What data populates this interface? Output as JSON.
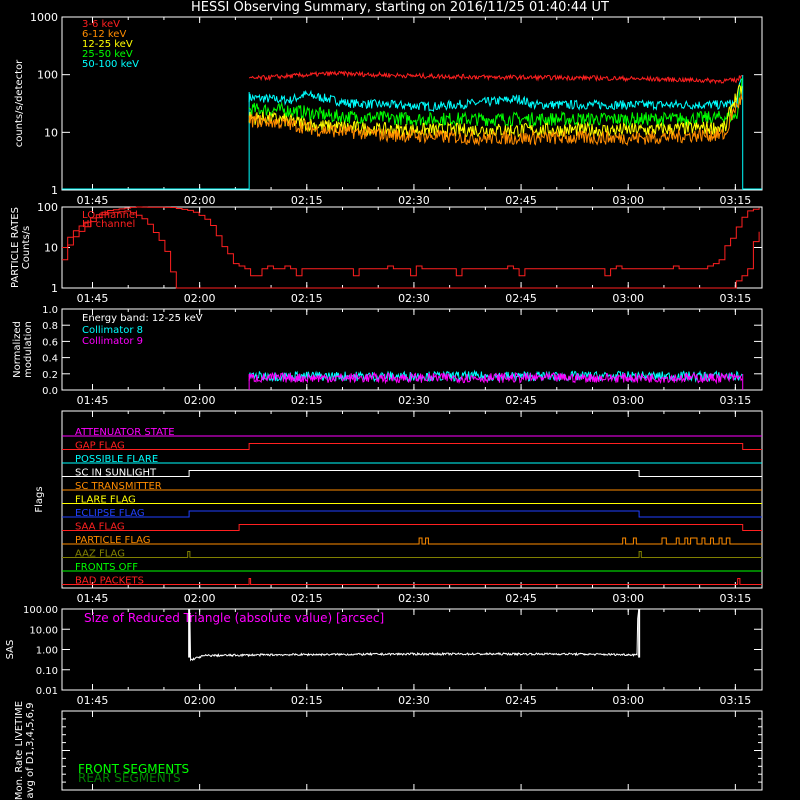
{
  "title": "HESSI Observing Summary, starting on 2016/11/25 01:40:44 UT",
  "time_ticks": [
    "01:45",
    "02:00",
    "02:15",
    "02:30",
    "02:45",
    "03:00",
    "03:15"
  ],
  "chart_data": [
    {
      "type": "line",
      "name": "lightcurves",
      "ylabel": "counts/s/detector",
      "yscale": "log",
      "ylim": [
        1,
        1000
      ],
      "yticks": [
        "1",
        "10",
        "100",
        "1000"
      ],
      "legend_position": "top-left",
      "xrange_minutes": [
        0,
        98
      ],
      "series": [
        {
          "name": "3-6 keV",
          "color": "#ff2020",
          "start": 26.2,
          "end": 95.3,
          "points": [
            [
              26.2,
              85
            ],
            [
              32,
              95
            ],
            [
              38,
              105
            ],
            [
              50,
              95
            ],
            [
              62,
              90
            ],
            [
              74,
              88
            ],
            [
              86,
              82
            ],
            [
              92,
              78
            ],
            [
              94.5,
              80
            ],
            [
              95.3,
              100
            ]
          ]
        },
        {
          "name": "6-12 keV",
          "color": "#ff8c00",
          "start": 26.2,
          "end": 95.3,
          "points": [
            [
              26.2,
              16
            ],
            [
              30,
              15
            ],
            [
              36,
              11
            ],
            [
              46,
              9
            ],
            [
              58,
              8
            ],
            [
              70,
              8
            ],
            [
              82,
              8
            ],
            [
              90,
              9
            ],
            [
              93,
              9
            ],
            [
              95.3,
              40
            ]
          ]
        },
        {
          "name": "12-25 keV",
          "color": "#ffff00",
          "start": 26.2,
          "end": 95.3,
          "points": [
            [
              26.2,
              18
            ],
            [
              30,
              17
            ],
            [
              36,
              13
            ],
            [
              46,
              11
            ],
            [
              58,
              11
            ],
            [
              70,
              11
            ],
            [
              82,
              11
            ],
            [
              90,
              12
            ],
            [
              93,
              12
            ],
            [
              95.3,
              60
            ]
          ]
        },
        {
          "name": "25-50 keV",
          "color": "#00ff00",
          "start": 26.2,
          "end": 95.3,
          "points": [
            [
              26.2,
              25
            ],
            [
              32,
              24
            ],
            [
              38,
              19
            ],
            [
              50,
              17
            ],
            [
              62,
              17
            ],
            [
              74,
              17
            ],
            [
              86,
              17
            ],
            [
              92,
              18
            ],
            [
              94.5,
              19
            ],
            [
              95.3,
              80
            ]
          ]
        },
        {
          "name": "50-100 keV",
          "color": "#00ffff",
          "start": 26.2,
          "end": 95.3,
          "points": [
            [
              26.2,
              40
            ],
            [
              32,
              36
            ],
            [
              34,
              45
            ],
            [
              40,
              32
            ],
            [
              52,
              28
            ],
            [
              58,
              32
            ],
            [
              64,
              38
            ],
            [
              66,
              30
            ],
            [
              76,
              30
            ],
            [
              86,
              30
            ],
            [
              92,
              30
            ],
            [
              94.5,
              32
            ],
            [
              95.3,
              100
            ]
          ]
        }
      ]
    },
    {
      "type": "line",
      "name": "particle_rates",
      "ylabel": "PARTICLE RATES Counts/s",
      "yscale": "log",
      "ylim": [
        1,
        100
      ],
      "yticks": [
        "1",
        "10",
        "100"
      ],
      "series": [
        {
          "name": "LO channel",
          "color": "#ff2020",
          "points": [
            [
              0,
              10
            ],
            [
              3,
              40
            ],
            [
              6,
              80
            ],
            [
              10,
              100
            ],
            [
              15,
              98
            ],
            [
              18,
              80
            ],
            [
              20,
              50
            ],
            [
              22,
              12
            ],
            [
              24,
              4
            ],
            [
              26,
              3
            ],
            [
              40,
              3
            ],
            [
              52,
              3
            ],
            [
              64,
              3
            ],
            [
              76,
              3
            ],
            [
              90,
              3
            ],
            [
              92,
              5
            ],
            [
              94,
              20
            ],
            [
              96,
              80
            ],
            [
              98,
              100
            ]
          ]
        },
        {
          "name": "HI channel",
          "color": "#ff2020",
          "points": [
            [
              0,
              5
            ],
            [
              3,
              30
            ],
            [
              6,
              70
            ],
            [
              9,
              80
            ],
            [
              11,
              55
            ],
            [
              13,
              20
            ],
            [
              15,
              3
            ],
            [
              16,
              1
            ],
            [
              94,
              1
            ],
            [
              96,
              3
            ],
            [
              98,
              30
            ]
          ]
        }
      ]
    },
    {
      "type": "line",
      "name": "modulation",
      "ylabel": "Normalized modulation",
      "ylim": [
        0,
        1
      ],
      "yticks": [
        "0.0",
        "0.2",
        "0.4",
        "0.6",
        "0.8",
        "1.0"
      ],
      "annotation": "Energy band: 12-25 keV",
      "series": [
        {
          "name": "Collimator 8",
          "color": "#00ffff",
          "level": 0.17,
          "start": 26.2,
          "end": 95.3
        },
        {
          "name": "Collimator 9",
          "color": "#ff00ff",
          "level": 0.15,
          "start": 26.2,
          "end": 95.3
        }
      ]
    },
    {
      "type": "line",
      "name": "flags",
      "ylabel": "Flags",
      "series": [
        {
          "name": "ATTENUATOR STATE",
          "color": "#ff00ff",
          "steps": []
        },
        {
          "name": "GAP FLAG",
          "color": "#ff2020",
          "steps": [
            [
              26.2,
              95.3
            ]
          ]
        },
        {
          "name": "POSSIBLE FLARE",
          "color": "#00ffff",
          "steps": []
        },
        {
          "name": "SC IN SUNLIGHT",
          "color": "#ffffff",
          "steps": [
            [
              17.8,
              80.8
            ]
          ]
        },
        {
          "name": "SC TRANSMITTER",
          "color": "#ff8c00",
          "steps": []
        },
        {
          "name": "FLARE FLAG",
          "color": "#ffff00",
          "steps": []
        },
        {
          "name": "ECLIPSE FLAG",
          "color": "#2040ff",
          "steps": [
            [
              17.8,
              80.8
            ]
          ]
        },
        {
          "name": "SAA FLAG",
          "color": "#ff2020",
          "steps": [
            [
              24.8,
              95.3
            ]
          ]
        },
        {
          "name": "PARTICLE FLAG",
          "color": "#ff8c00",
          "steps": [
            [
              50.0,
              50.4
            ],
            [
              50.9,
              51.3
            ],
            [
              78.5,
              78.9
            ],
            [
              80.0,
              80.4
            ],
            [
              84.0,
              84.6
            ],
            [
              86.0,
              86.4
            ],
            [
              87.2,
              87.6
            ],
            [
              88.0,
              88.9
            ],
            [
              89.6,
              90.0
            ],
            [
              90.8,
              91.2
            ],
            [
              92.0,
              92.4
            ],
            [
              93.0,
              93.5
            ]
          ]
        },
        {
          "name": "AAZ FLAG",
          "color": "#808000",
          "steps": [
            [
              17.6,
              17.9
            ],
            [
              80.8,
              81.1
            ]
          ]
        },
        {
          "name": "FRONTS OFF",
          "color": "#00ff00",
          "steps": []
        },
        {
          "name": "BAD PACKETS",
          "color": "#ff2020",
          "steps": [
            [
              26.2,
              26.4
            ],
            [
              94.6,
              94.9
            ]
          ]
        }
      ]
    },
    {
      "type": "line",
      "name": "sas",
      "ylabel": "SAS",
      "yscale": "log",
      "ylim": [
        0.01,
        100
      ],
      "yticks": [
        "0.01",
        "0.10",
        "1.00",
        "10.00",
        "100.00"
      ],
      "annotation": "Size of Reduced Triangle (absolute value) [arcsec]",
      "series": [
        {
          "name": "Size of Reduced Triangle",
          "color": "#ffffff",
          "points": [
            [
              17.8,
              100
            ],
            [
              18.0,
              0.3
            ],
            [
              20,
              0.5
            ],
            [
              30,
              0.55
            ],
            [
              50,
              0.6
            ],
            [
              70,
              0.6
            ],
            [
              80.5,
              0.55
            ],
            [
              80.8,
              100
            ]
          ]
        }
      ]
    },
    {
      "type": "line",
      "name": "livetime",
      "ylabel": "Mon. Rate LIVETIME avg of D1,3,4,5,6,9",
      "series": [
        {
          "name": "FRONT SEGMENTS",
          "color": "#00ff00"
        },
        {
          "name": "REAR SEGMENTS",
          "color": "#008000"
        }
      ]
    }
  ]
}
